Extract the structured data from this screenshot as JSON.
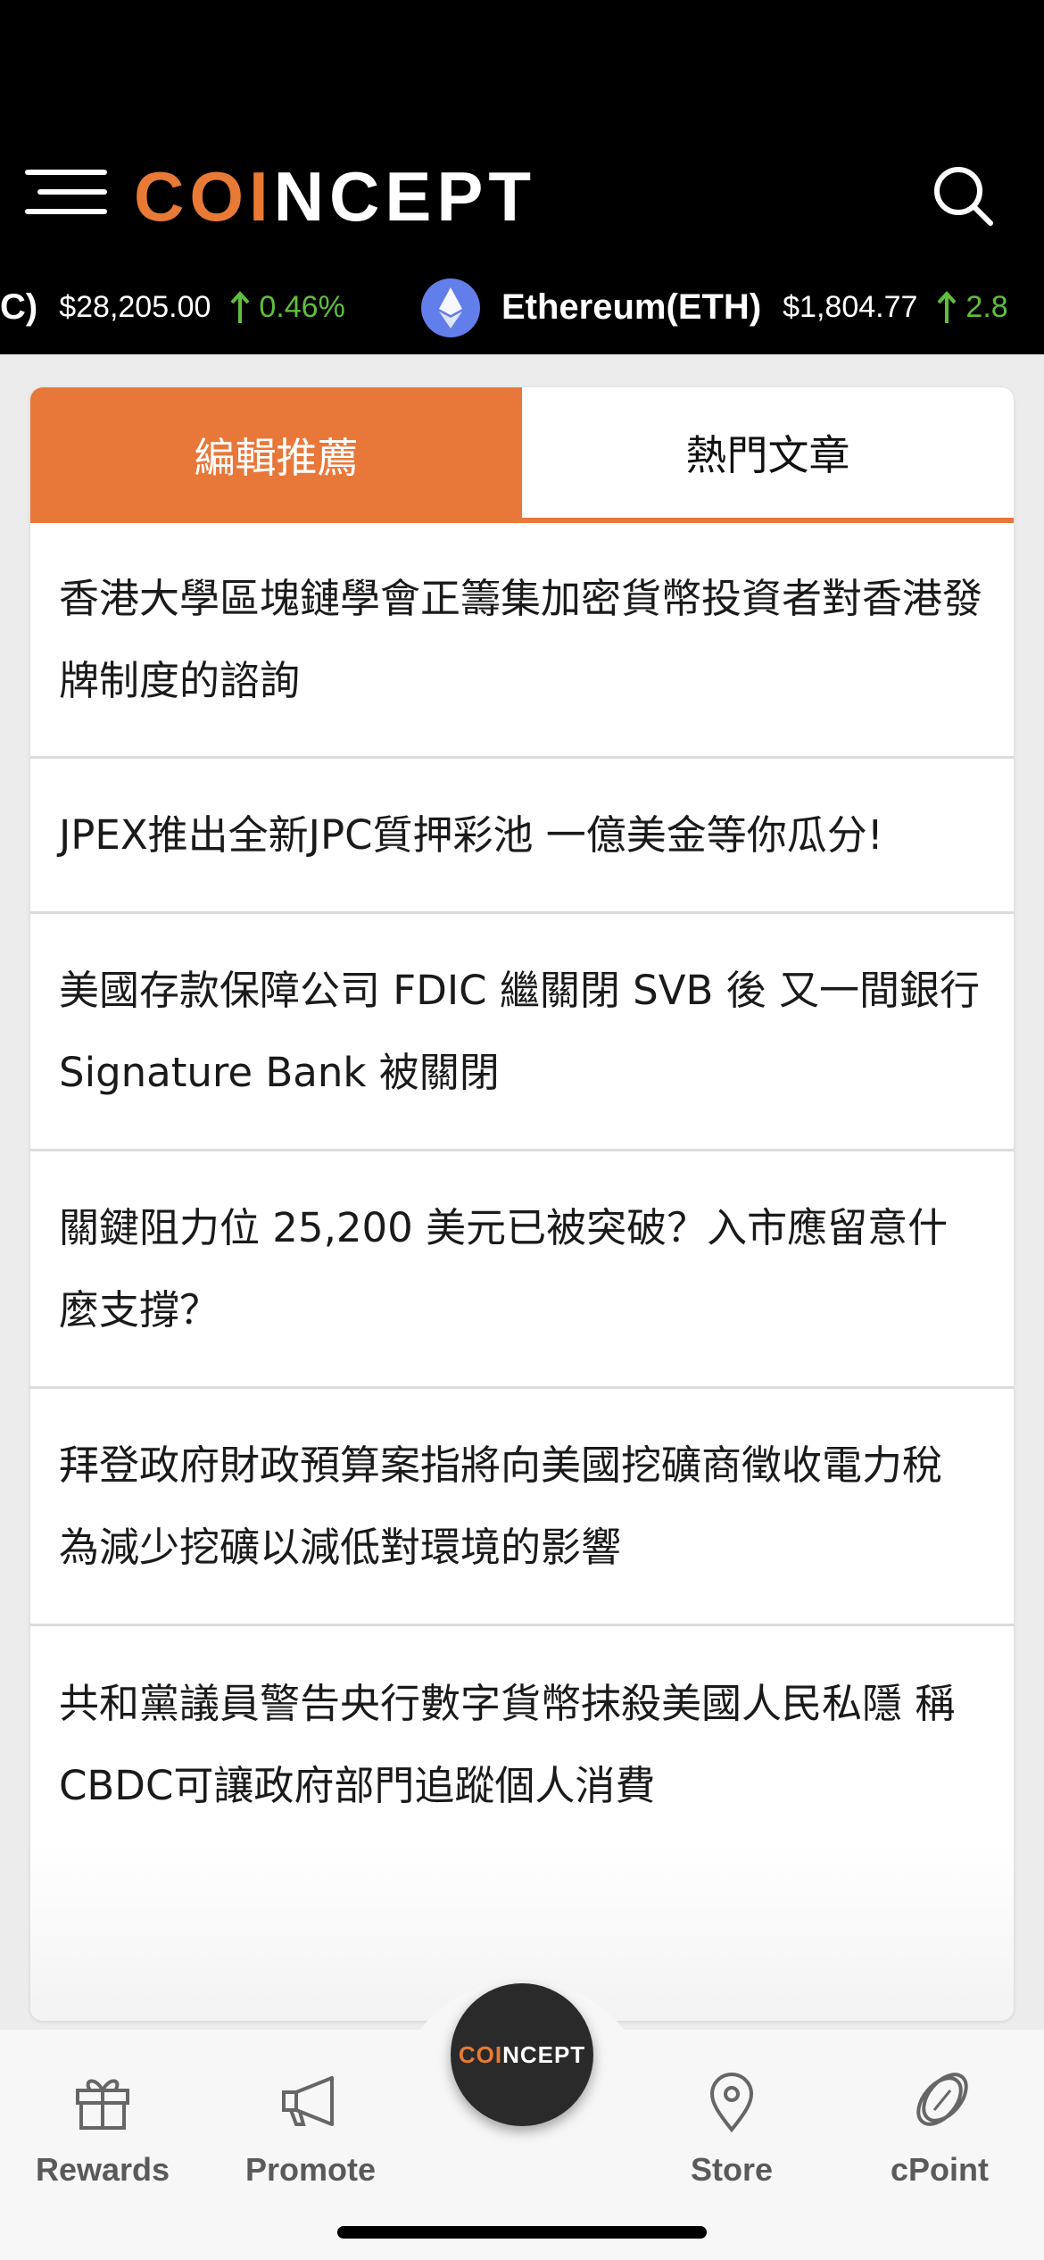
{
  "header": {
    "logo_prefix": "C",
    "logo_o": "O",
    "logo_i": "I",
    "logo_suffix": "NCEPT"
  },
  "ticker": [
    {
      "name": "C)",
      "price": "$28,205.00",
      "change": "0.46%"
    },
    {
      "name": "Ethereum(ETH)",
      "price": "$1,804.77",
      "change": "2.8"
    }
  ],
  "tabs": [
    {
      "label": "編輯推薦"
    },
    {
      "label": "熱門文章"
    }
  ],
  "articles": [
    {
      "title": "香港大學區塊鏈學會正籌集加密貨幣投資者對香港發牌制度的諮詢"
    },
    {
      "title": "JPEX推出全新JPC質押彩池 一億美金等你瓜分!"
    },
    {
      "title": "美國存款保障公司 FDIC 繼關閉 SVB 後 又一間銀行 Signature Bank 被關閉"
    },
    {
      "title": "關鍵阻力位 25,200 美元已被突破？入市應留意什麼支撐？"
    },
    {
      "title": "拜登政府財政預算案指將向美國挖礦商徵收電力稅 為減少挖礦以減低對環境的影響"
    },
    {
      "title": "共和黨議員警告央行數字貨幣抹殺美國人民私隱 稱CBDC可讓政府部門追蹤個人消費"
    }
  ],
  "bottom_nav": {
    "items": [
      {
        "label": "Rewards",
        "icon": "gift-icon"
      },
      {
        "label": "Promote",
        "icon": "megaphone-icon"
      },
      {
        "label": "Store",
        "icon": "location-pin-icon"
      },
      {
        "label": "cPoint",
        "icon": "coin-icon"
      }
    ],
    "fab_logo_prefix": "C",
    "fab_logo_o": "O",
    "fab_logo_i": "I",
    "fab_logo_suffix": "NCEPT"
  },
  "colors": {
    "accent": "#e8783a",
    "positive": "#5fbf3d",
    "header_bg": "#000000",
    "eth": "#627eea"
  }
}
